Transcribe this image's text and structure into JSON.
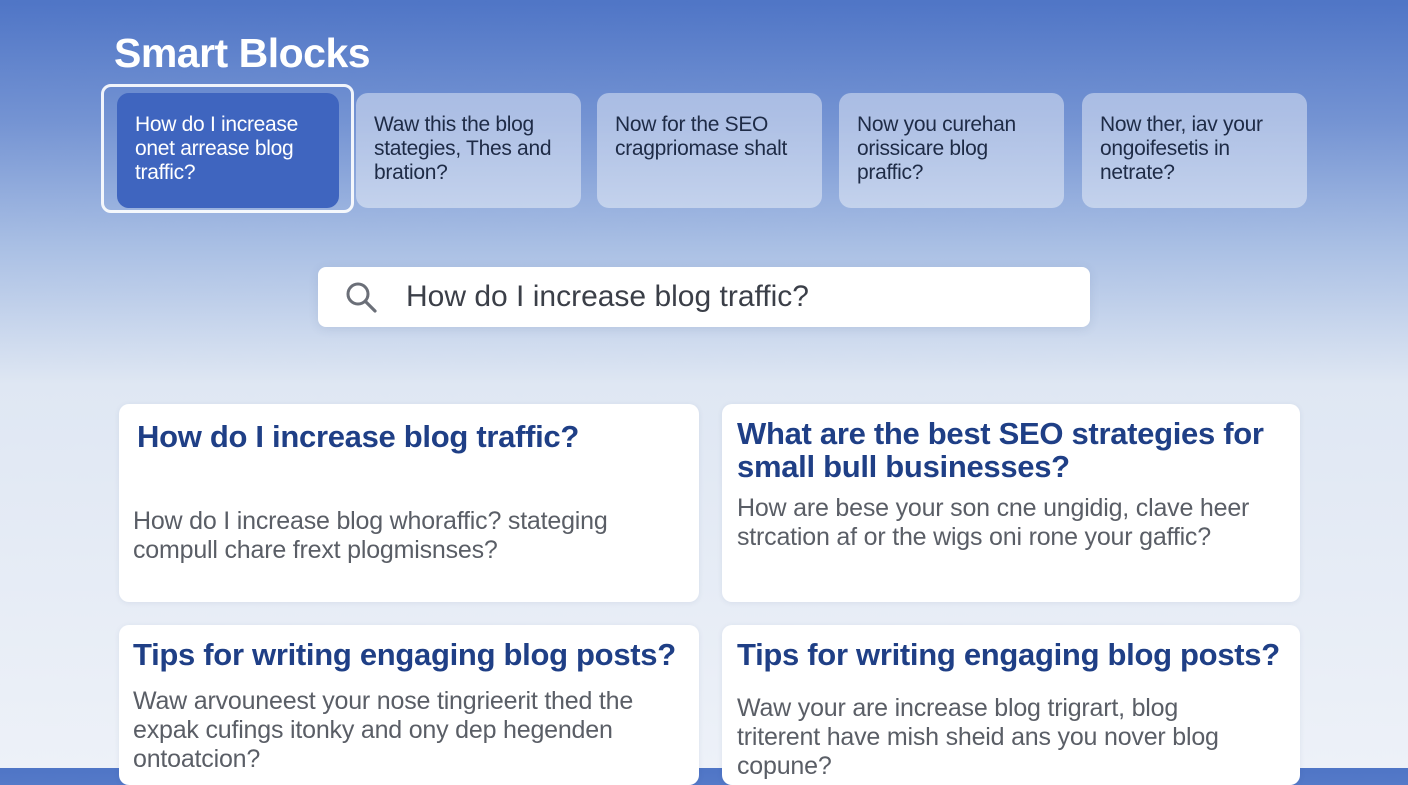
{
  "app": {
    "title": "Smart Blocks"
  },
  "chips": [
    {
      "label": "How do I increase onet arrease blog traffic?"
    },
    {
      "label": "Waw this the blog stategies, Thes and bration?"
    },
    {
      "label": "Now for the SEO cragpriomase shalt"
    },
    {
      "label": "Now you curehan orissicare blog praffic?"
    },
    {
      "label": "Now ther, iav your ongoifesetis in netrate?"
    }
  ],
  "search": {
    "value": "How do I increase blog traffic?",
    "icon": "search-icon"
  },
  "cards": [
    {
      "title": "How do I increase blog traffic?",
      "body": "How do I increase blog whoraffic? stateging compull chare frext plogmisnses?"
    },
    {
      "title": "What are the best SEO strategies for small bull businesses?",
      "body": "How are bese your son cne ungidig, clave heer strcation af or the wigs oni rone your gaffic?"
    },
    {
      "title": "Tips for writing engaging blog posts?",
      "body": "Waw arvouneest your nose tingrieerit thed the expak cufings itonky and ony dep hegenden ontoatcion?"
    },
    {
      "title": "Tips for writing engaging blog posts?",
      "body": "Waw your are increase blog trigrart, blog triterent have mish sheid ans you nover blog copune?"
    }
  ],
  "colors": {
    "accent": "#3f65bf",
    "card_title": "#1f3f86"
  }
}
